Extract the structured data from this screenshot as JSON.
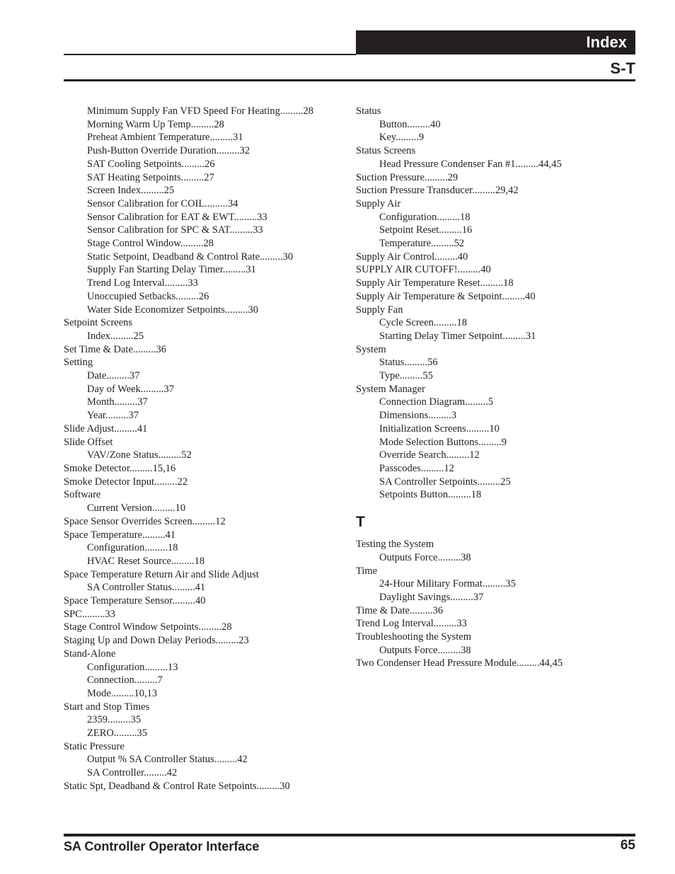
{
  "header": {
    "title": "Index",
    "section_range": "S-T"
  },
  "left_column": [
    {
      "text": "Minimum Supply Fan VFD Speed For Heating.........28",
      "sub": true
    },
    {
      "text": "Morning Warm Up Temp.........28",
      "sub": true
    },
    {
      "text": "Preheat Ambient Temperature.........31",
      "sub": true
    },
    {
      "text": "Push-Button Override Duration.........32",
      "sub": true
    },
    {
      "text": "SAT Cooling Setpoints.........26",
      "sub": true
    },
    {
      "text": "SAT Heating Setpoints.........27",
      "sub": true
    },
    {
      "text": "Screen Index.........25",
      "sub": true
    },
    {
      "text": "Sensor Calibration for COIL.........34",
      "sub": true
    },
    {
      "text": "Sensor Calibration for EAT & EWT.........33",
      "sub": true
    },
    {
      "text": "Sensor Calibration for SPC & SAT.........33",
      "sub": true
    },
    {
      "text": "Stage Control Window.........28",
      "sub": true
    },
    {
      "text": "Static Setpoint, Deadband & Control Rate.........30",
      "sub": true
    },
    {
      "text": "Supply Fan Starting Delay Timer.........31",
      "sub": true
    },
    {
      "text": "Trend Log Interval.........33",
      "sub": true
    },
    {
      "text": "Unoccupied Setbacks.........26",
      "sub": true
    },
    {
      "text": "Water Side Economizer Setpoints.........30",
      "sub": true
    },
    {
      "text": "Setpoint Screens",
      "sub": false
    },
    {
      "text": "Index.........25",
      "sub": true
    },
    {
      "text": "Set Time & Date.........36",
      "sub": false
    },
    {
      "text": "Setting",
      "sub": false
    },
    {
      "text": "Date.........37",
      "sub": true
    },
    {
      "text": "Day of Week.........37",
      "sub": true
    },
    {
      "text": "Month.........37",
      "sub": true
    },
    {
      "text": "Year.........37",
      "sub": true
    },
    {
      "text": "Slide Adjust.........41",
      "sub": false
    },
    {
      "text": "Slide Offset",
      "sub": false
    },
    {
      "text": "VAV/Zone Status.........52",
      "sub": true
    },
    {
      "text": "Smoke Detector.........15,16",
      "sub": false
    },
    {
      "text": "Smoke Detector Input.........22",
      "sub": false
    },
    {
      "text": "Software",
      "sub": false
    },
    {
      "text": "Current Version.........10",
      "sub": true
    },
    {
      "text": "Space Sensor Overrides Screen.........12",
      "sub": false
    },
    {
      "text": "Space Temperature.........41",
      "sub": false
    },
    {
      "text": "Configuration.........18",
      "sub": true
    },
    {
      "text": "HVAC Reset Source.........18",
      "sub": true
    },
    {
      "text": "Space Temperature Return Air and Slide Adjust",
      "sub": false
    },
    {
      "text": "SA Controller Status.........41",
      "sub": true
    },
    {
      "text": "Space Temperature Sensor.........40",
      "sub": false
    },
    {
      "text": "SPC.........33",
      "sub": false
    },
    {
      "text": "Stage Control Window Setpoints.........28",
      "sub": false
    },
    {
      "text": "Staging Up and Down Delay Periods.........23",
      "sub": false
    },
    {
      "text": "Stand-Alone",
      "sub": false
    },
    {
      "text": "Configuration.........13",
      "sub": true
    },
    {
      "text": "Connection.........7",
      "sub": true
    },
    {
      "text": "Mode.........10,13",
      "sub": true
    },
    {
      "text": "Start and Stop Times",
      "sub": false
    },
    {
      "text": "2359.........35",
      "sub": true
    },
    {
      "text": "ZERO.........35",
      "sub": true
    },
    {
      "text": "Static Pressure",
      "sub": false
    },
    {
      "text": "Output % SA Controller Status.........42",
      "sub": true
    },
    {
      "text": "SA Controller.........42",
      "sub": true
    },
    {
      "text": "Static Spt, Deadband & Control Rate Setpoints.........30",
      "sub": false
    }
  ],
  "right_column_s": [
    {
      "text": "Status",
      "sub": false
    },
    {
      "text": "Button.........40",
      "sub": true
    },
    {
      "text": "Key.........9",
      "sub": true
    },
    {
      "text": "Status Screens",
      "sub": false
    },
    {
      "text": "Head Pressure Condenser Fan #1.........44,45",
      "sub": true
    },
    {
      "text": "Suction Pressure.........29",
      "sub": false
    },
    {
      "text": "Suction Pressure Transducer.........29,42",
      "sub": false
    },
    {
      "text": "Supply Air",
      "sub": false
    },
    {
      "text": "Configuration.........18",
      "sub": true
    },
    {
      "text": "Setpoint Reset.........16",
      "sub": true
    },
    {
      "text": "Temperature.........52",
      "sub": true
    },
    {
      "text": "Supply Air Control.........40",
      "sub": false
    },
    {
      "text": "SUPPLY AIR CUTOFF!.........40",
      "sub": false
    },
    {
      "text": "Supply Air Temperature Reset.........18",
      "sub": false
    },
    {
      "text": "Supply Air Temperature & Setpoint.........40",
      "sub": false
    },
    {
      "text": "Supply Fan",
      "sub": false
    },
    {
      "text": "Cycle Screen.........18",
      "sub": true
    },
    {
      "text": "Starting Delay Timer Setpoint.........31",
      "sub": true
    },
    {
      "text": "System",
      "sub": false
    },
    {
      "text": "Status.........56",
      "sub": true
    },
    {
      "text": "Type.........55",
      "sub": true
    },
    {
      "text": "System Manager",
      "sub": false
    },
    {
      "text": "Connection Diagram.........5",
      "sub": true
    },
    {
      "text": "Dimensions.........3",
      "sub": true
    },
    {
      "text": "Initialization Screens.........10",
      "sub": true
    },
    {
      "text": "Mode Selection Buttons.........9",
      "sub": true
    },
    {
      "text": "Override Search.........12",
      "sub": true
    },
    {
      "text": "Passcodes.........12",
      "sub": true
    },
    {
      "text": "SA Controller Setpoints.........25",
      "sub": true
    },
    {
      "text": "Setpoints Button.........18",
      "sub": true
    }
  ],
  "section_t": {
    "letter": "T",
    "entries": [
      {
        "text": "Testing the System",
        "sub": false
      },
      {
        "text": "Outputs Force.........38",
        "sub": true
      },
      {
        "text": "Time",
        "sub": false
      },
      {
        "text": "24-Hour Military Format.........35",
        "sub": true
      },
      {
        "text": "Daylight Savings.........37",
        "sub": true
      },
      {
        "text": "Time & Date.........36",
        "sub": false
      },
      {
        "text": "Trend Log Interval.........33",
        "sub": false
      },
      {
        "text": "Troubleshooting the System",
        "sub": false
      },
      {
        "text": "Outputs Force.........38",
        "sub": true
      },
      {
        "text": "Two Condenser Head Pressure Module.........44,45",
        "sub": false
      }
    ]
  },
  "footer": {
    "doc_title": "SA Controller Operator Interface",
    "page_number": "65"
  }
}
